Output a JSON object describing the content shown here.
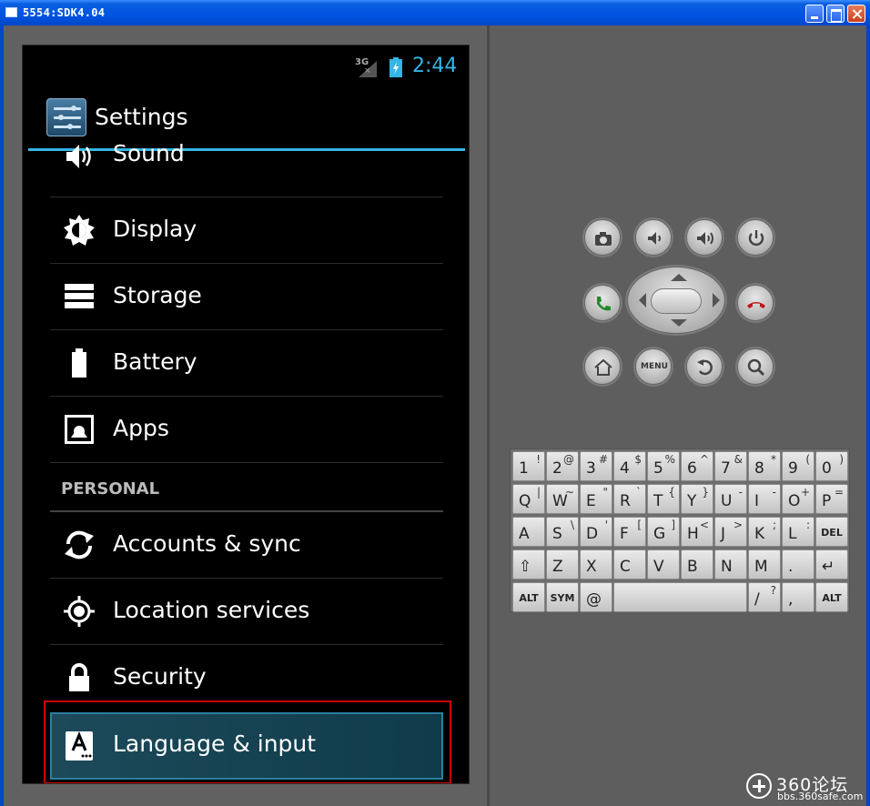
{
  "window": {
    "title": "5554:SDK4.04"
  },
  "status": {
    "network": "3G",
    "time": "2:44",
    "accent": "#33b5e5"
  },
  "actionbar": {
    "title": "Settings"
  },
  "settings": {
    "items_device": [
      {
        "label": "Sound",
        "icon": "sound-icon"
      },
      {
        "label": "Display",
        "icon": "display-icon"
      },
      {
        "label": "Storage",
        "icon": "storage-icon"
      },
      {
        "label": "Battery",
        "icon": "battery-icon"
      },
      {
        "label": "Apps",
        "icon": "apps-icon"
      }
    ],
    "section_personal": "PERSONAL",
    "items_personal": [
      {
        "label": "Accounts & sync",
        "icon": "sync-icon"
      },
      {
        "label": "Location services",
        "icon": "location-icon"
      },
      {
        "label": "Security",
        "icon": "lock-icon"
      },
      {
        "label": "Language & input",
        "icon": "language-icon",
        "selected": true
      }
    ]
  },
  "hardware": {
    "menu_label": "MENU"
  },
  "keyboard": {
    "rows": [
      [
        [
          "1",
          "!"
        ],
        [
          "2",
          "@"
        ],
        [
          "3",
          "#"
        ],
        [
          "4",
          "$"
        ],
        [
          "5",
          "%"
        ],
        [
          "6",
          "^"
        ],
        [
          "7",
          "&"
        ],
        [
          "8",
          "*"
        ],
        [
          "9",
          "("
        ],
        [
          "0",
          ")"
        ]
      ],
      [
        [
          "Q",
          "|"
        ],
        [
          "W",
          "~"
        ],
        [
          "E",
          "\""
        ],
        [
          "R",
          "`"
        ],
        [
          "T",
          "{"
        ],
        [
          "Y",
          "}"
        ],
        [
          "U",
          "-"
        ],
        [
          "I",
          "-"
        ],
        [
          "O",
          "+"
        ],
        [
          "P",
          "="
        ]
      ],
      [
        [
          "A",
          ""
        ],
        [
          "S",
          "\\"
        ],
        [
          "D",
          "'"
        ],
        [
          "F",
          "["
        ],
        [
          "G",
          "]"
        ],
        [
          "H",
          "<"
        ],
        [
          "J",
          ">"
        ],
        [
          "K",
          ";"
        ],
        [
          "L",
          ":"
        ],
        [
          "DEL",
          ""
        ]
      ],
      [
        [
          "⇧",
          ""
        ],
        [
          "Z",
          ""
        ],
        [
          "X",
          ""
        ],
        [
          "C",
          ""
        ],
        [
          "V",
          ""
        ],
        [
          "B",
          ""
        ],
        [
          "N",
          ""
        ],
        [
          "M",
          ""
        ],
        [
          ".",
          ""
        ],
        [
          "↵",
          ""
        ]
      ],
      [
        [
          "ALT",
          ""
        ],
        [
          "SYM",
          ""
        ],
        [
          "@",
          ""
        ],
        [
          "",
          ""
        ],
        [
          "/",
          "?"
        ],
        [
          ",",
          ""
        ],
        [
          "ALT",
          ""
        ]
      ]
    ]
  },
  "watermark": {
    "brand": "360论坛",
    "url": "bbs.360safe.com"
  }
}
